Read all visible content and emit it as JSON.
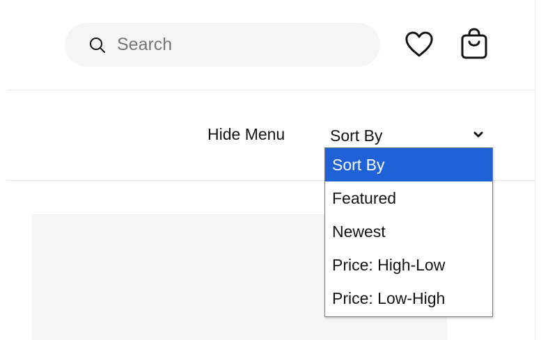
{
  "header": {
    "search": {
      "placeholder": "Search",
      "icon": "search-icon"
    },
    "favorites_icon": "heart-icon",
    "bag_icon": "shopping-bag-icon"
  },
  "filter_bar": {
    "hide_menu_label": "Hide Menu",
    "sort": {
      "selected_label": "Sort By",
      "chevron_icon": "chevron-down-icon",
      "options": [
        {
          "label": "Sort By",
          "selected": true
        },
        {
          "label": "Featured",
          "selected": false
        },
        {
          "label": "Newest",
          "selected": false
        },
        {
          "label": "Price: High-Low",
          "selected": false
        },
        {
          "label": "Price: Low-High",
          "selected": false
        }
      ]
    }
  },
  "colors": {
    "selected_option_bg": "#1f62d7",
    "search_bg": "#f5f5f5",
    "card_bg": "#f5f5f5"
  }
}
